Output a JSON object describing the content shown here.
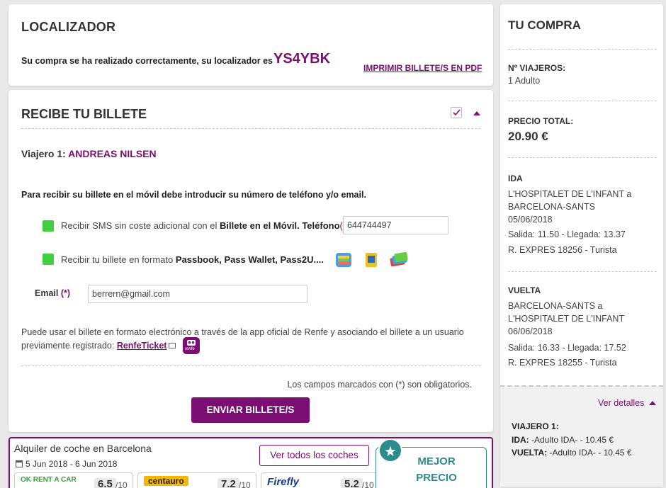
{
  "localizador": {
    "title": "LOCALIZADOR",
    "message": "Su compra se ha realizado correctamente, su localizador es",
    "code": "YS4YBK",
    "print_link": "IMPRIMIR BILLETE/S EN PDF"
  },
  "recibe": {
    "title": "RECIBE TU BILLETE",
    "viajero_label": "Viajero 1:",
    "viajero_name": "ANDREAS NILSEN",
    "instruction": "Para recibir su billete en el móvil debe introducir su número de teléfono y/o email.",
    "sms_prefix": "Recibir SMS sin coste adicional con el",
    "sms_bold": "Billete en el Móvil. Teléfono",
    "sms_req": "(*)",
    "phone_value": "644744497",
    "passbook_prefix": "Recibir tu billete en formato",
    "passbook_bold": "Passbook, Pass Wallet, Pass2U....",
    "email_label": "Email",
    "email_req": "(*)",
    "email_value": "berrern@gmail.com",
    "info_line1": "Puede usar el billete en formato electrónico a través de la app oficial de Renfe y asociando el billete a un usuario",
    "info_line2": "previamente registrado:",
    "renfe_link": "RenfeTicket",
    "renfe_badge": "renfe",
    "obligatorios": "Los campos marcados con (*) son obligatorios.",
    "send_button": "ENVIAR BILLETE/S",
    "colors": {
      "accent": "#7b0e72",
      "check": "#3fcf3f"
    }
  },
  "car": {
    "title": "Alquiler de coche en Barcelona",
    "dates": "5 Jun 2018 -  6 Jun 2018",
    "all_button": "Ver todos los coches",
    "best_price": "MEJOR PRECIO",
    "rentals": [
      {
        "logo": "OK RENT A CAR",
        "score": "6.5",
        "of": "/10"
      },
      {
        "logo": "centauro",
        "score": "7.2",
        "of": "/10"
      },
      {
        "logo": "Firefly",
        "score": "5.2",
        "of": "/10"
      }
    ]
  },
  "compra": {
    "title": "TU COMPRA",
    "viajeros_label": "Nº VIAJEROS:",
    "viajeros_value": "1 Adulto",
    "precio_label": "PRECIO TOTAL:",
    "precio_value": "20.90 €",
    "ida_label": "IDA",
    "ida_route": "L'HOSPITALET DE L'INFANT a BARCELONA-SANTS",
    "ida_date": "05/06/2018",
    "ida_times": "Salida: 11.50 - Llegada: 13.37",
    "ida_train": "R. EXPRES 18256 - Turista",
    "vuelta_label": "VUELTA",
    "vuelta_route": "BARCELONA-SANTS a L'HOSPITALET DE L'INFANT",
    "vuelta_date": "06/06/2018",
    "vuelta_times": "Salida: 16.33 - Llegada: 17.52",
    "vuelta_train": "R. EXPRES 18255 - Turista",
    "ver_detalles": "Ver detalles",
    "viajero1": "VIAJERO 1:",
    "ida_short": "IDA:",
    "ida_detail": " -Adulto IDA- - 10.45 €",
    "vuelta_short": "VUELTA:",
    "vuelta_detail": " -Adulto IDA- - 10.45 €"
  }
}
